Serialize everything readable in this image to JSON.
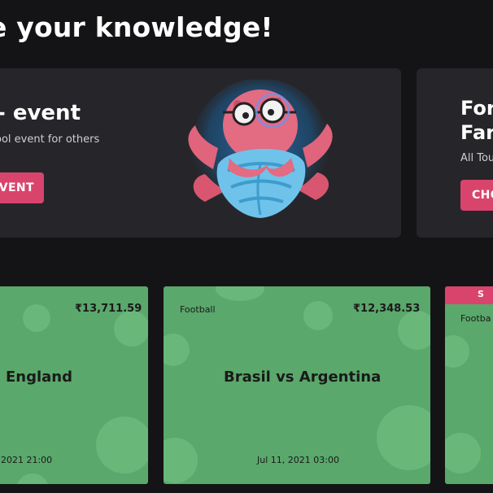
{
  "heading": "e your knowledge!",
  "create_panel": {
    "title": "- event",
    "subtitle": "ool event for others",
    "button_label": "VENT"
  },
  "follow_panel": {
    "title_line1": "For",
    "title_line2": "Far",
    "subtitle": "All Tou",
    "button_label": "CHO"
  },
  "section_label": ":",
  "cards": [
    {
      "sport": "",
      "amount": "₹13,711.59",
      "match": "s England",
      "date": ", 2021 21:00"
    },
    {
      "sport": "Football",
      "amount": "₹12,348.53",
      "match": "Brasil vs Argentina",
      "date": "Jul 11, 2021 03:00"
    },
    {
      "sport": "Footba",
      "banner": "S"
    }
  ],
  "colors": {
    "background": "#141416",
    "panel": "#26262a",
    "accent_pink": "#d9446d",
    "card_green": "#5aa86b"
  }
}
